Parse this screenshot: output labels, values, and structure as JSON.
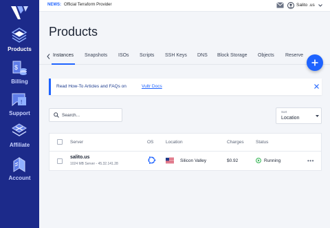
{
  "sidebar": {
    "items": [
      {
        "label": "Products",
        "icon": "products-icon"
      },
      {
        "label": "Billing",
        "icon": "billing-icon"
      },
      {
        "label": "Support",
        "icon": "support-icon"
      },
      {
        "label": "Affiliate",
        "icon": "affiliate-icon"
      },
      {
        "label": "Account",
        "icon": "account-icon"
      }
    ]
  },
  "topbar": {
    "news_label": "NEWS:",
    "news_text": "Official Terraform Provider",
    "user_name": "Salito .us"
  },
  "page": {
    "title": "Products"
  },
  "tabs": [
    {
      "label": "Instances"
    },
    {
      "label": "Snapshots"
    },
    {
      "label": "ISOs"
    },
    {
      "label": "Scripts"
    },
    {
      "label": "SSH Keys"
    },
    {
      "label": "DNS"
    },
    {
      "label": "Block Storage"
    },
    {
      "label": "Objects"
    },
    {
      "label": "Reserve"
    }
  ],
  "banner": {
    "text": "Read How-To Articles and FAQs on",
    "link": "Vultr Docs"
  },
  "search": {
    "placeholder": "Search..."
  },
  "sort": {
    "label": "Sort",
    "value": "Location"
  },
  "table": {
    "headers": {
      "server": "Server",
      "os": "OS",
      "location": "Location",
      "charges": "Charges",
      "status": "Status"
    },
    "rows": [
      {
        "name": "salito.us",
        "meta": "1024 MB Server - 45.32.141.28",
        "location": "Silicon Valley",
        "charges": "$0.92",
        "status": "Running"
      }
    ]
  },
  "colors": {
    "sidebar": "#1c2a8a",
    "accent": "#1e63ff",
    "running": "#2bb24c"
  }
}
